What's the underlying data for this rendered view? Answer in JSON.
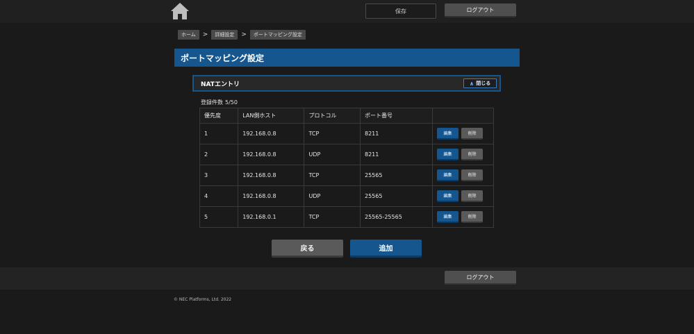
{
  "header": {
    "save_label": "保存",
    "logout_label": "ログアウト"
  },
  "breadcrumb": [
    "ホーム",
    "詳細設定",
    "ポートマッピング設定"
  ],
  "breadcrumb_sep": ">",
  "page_title": "ポートマッピング設定",
  "section": {
    "title": "NATエントリ",
    "close_label": "閉じる"
  },
  "count": {
    "label": "登録件数",
    "value": "5/50"
  },
  "table": {
    "headers": [
      "優先度",
      "LAN側ホスト",
      "プロトコル",
      "ポート番号",
      ""
    ],
    "rows": [
      {
        "priority": "1",
        "host": "192.168.0.8",
        "protocol": "TCP",
        "port": "8211"
      },
      {
        "priority": "2",
        "host": "192.168.0.8",
        "protocol": "UDP",
        "port": "8211"
      },
      {
        "priority": "3",
        "host": "192.168.0.8",
        "protocol": "TCP",
        "port": "25565"
      },
      {
        "priority": "4",
        "host": "192.168.0.8",
        "protocol": "UDP",
        "port": "25565"
      },
      {
        "priority": "5",
        "host": "192.168.0.1",
        "protocol": "TCP",
        "port": "25565-25565"
      }
    ],
    "edit_label": "編集",
    "delete_label": "削除"
  },
  "actions": {
    "back_label": "戻る",
    "add_label": "追加"
  },
  "footer": {
    "logout_label": "ログアウト",
    "copyright": "© NEC Platforms, Ltd. 2022"
  },
  "colors": {
    "accent": "#15568f",
    "background": "#1a1a1a"
  }
}
